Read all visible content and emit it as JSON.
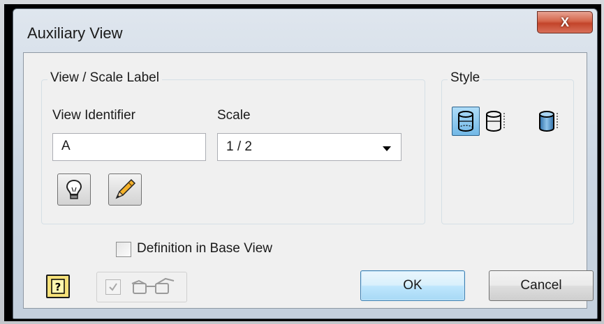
{
  "window": {
    "title": "Auxiliary View",
    "close_glyph": "X"
  },
  "view_scale_group": {
    "label": "View / Scale Label",
    "view_identifier_label": "View Identifier",
    "view_identifier_value": "A",
    "scale_label": "Scale",
    "scale_value": "1 / 2",
    "buttons": [
      {
        "icon": "lightbulb-icon"
      },
      {
        "icon": "pencil-icon"
      }
    ]
  },
  "style_group": {
    "label": "Style",
    "options": [
      {
        "icon": "hidden-line-style-icon",
        "selected": true
      },
      {
        "icon": "hidden-line-removed-style-icon",
        "selected": false
      },
      {
        "icon": "shaded-style-icon",
        "selected": false
      }
    ]
  },
  "definition_checkbox": {
    "label": "Definition in Base View",
    "checked": false
  },
  "footer": {
    "help_icon": "help-icon",
    "preview_icon": "glasses-icon",
    "preview_checked": true,
    "ok_label": "OK",
    "cancel_label": "Cancel"
  },
  "colors": {
    "accent": "#3c7fb1",
    "selected_style": "#72b8e6",
    "close": "#c3442a"
  }
}
